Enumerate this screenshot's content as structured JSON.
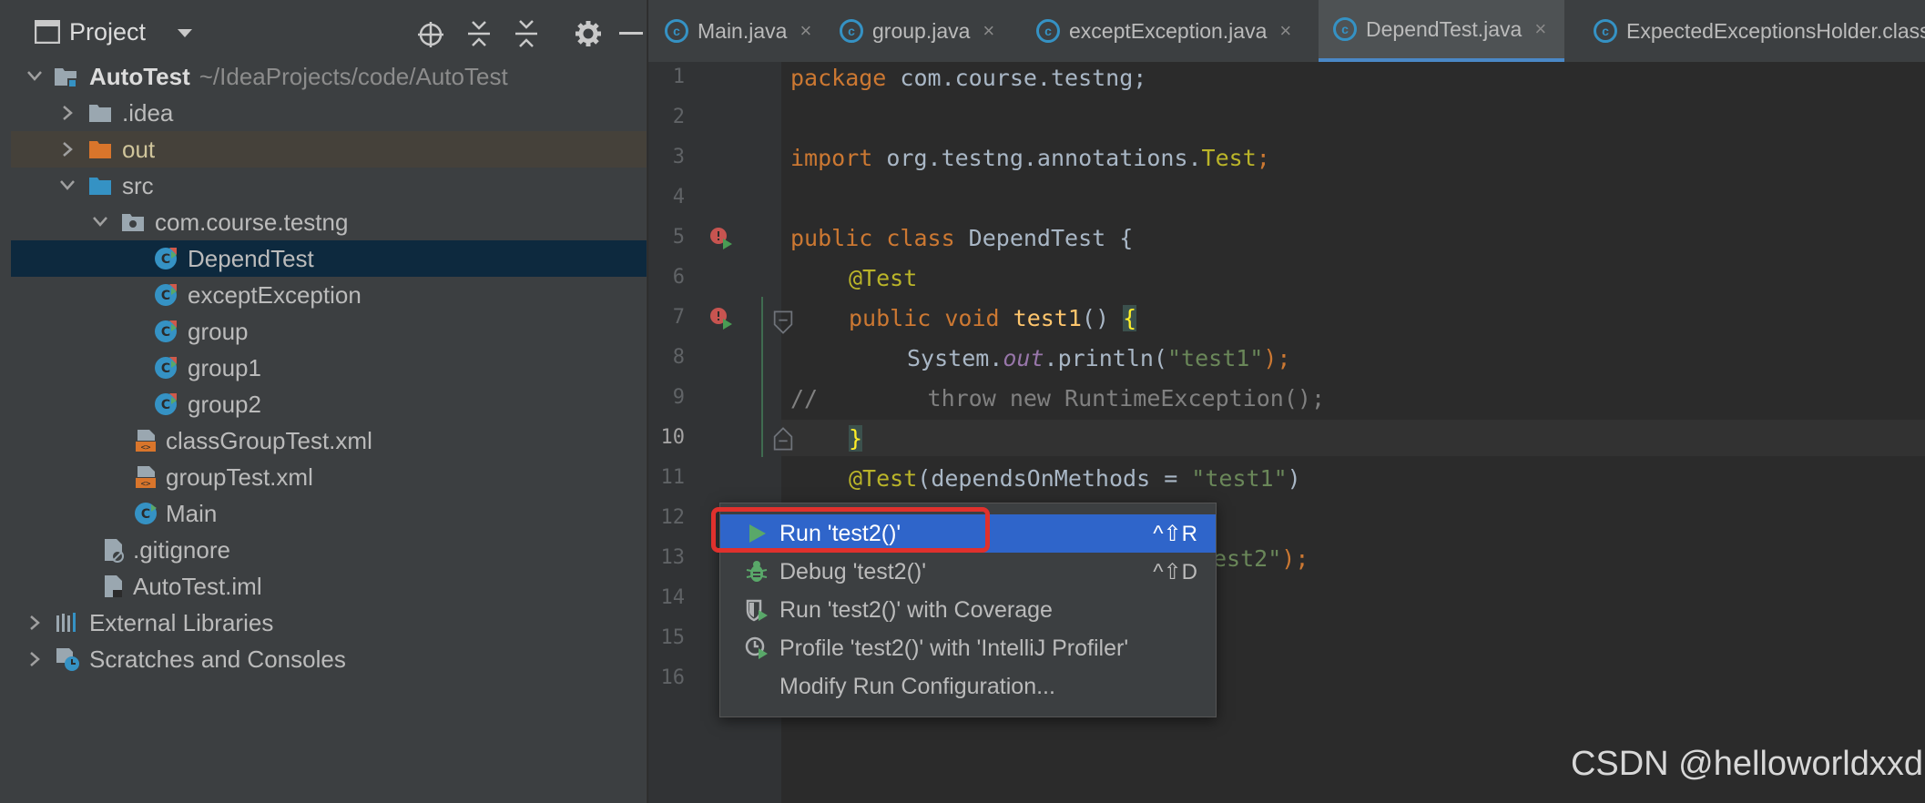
{
  "project_panel": {
    "title": "Project",
    "toolbar_icons": [
      "crosshair-icon",
      "expand-all-icon",
      "collapse-all-icon",
      "gear-icon",
      "minimize-icon"
    ],
    "tree": [
      {
        "label": "AutoTest",
        "path": "~/IdeaProjects/code/AutoTest",
        "icon": "module-folder-icon"
      },
      {
        "label": ".idea",
        "icon": "folder-icon"
      },
      {
        "label": "out",
        "icon": "excluded-folder-icon"
      },
      {
        "label": "src",
        "icon": "source-folder-icon"
      },
      {
        "label": "com.course.testng",
        "icon": "package-icon"
      },
      {
        "label": "DependTest",
        "icon": "test-class-icon"
      },
      {
        "label": "exceptException",
        "icon": "test-class-icon"
      },
      {
        "label": "group",
        "icon": "test-class-icon"
      },
      {
        "label": "group1",
        "icon": "test-class-icon"
      },
      {
        "label": "group2",
        "icon": "test-class-icon"
      },
      {
        "label": "classGroupTest.xml",
        "icon": "xml-file-icon"
      },
      {
        "label": "groupTest.xml",
        "icon": "xml-file-icon"
      },
      {
        "label": "Main",
        "icon": "class-run-icon"
      },
      {
        "label": ".gitignore",
        "icon": "ignore-file-icon"
      },
      {
        "label": "AutoTest.iml",
        "icon": "iml-file-icon"
      },
      {
        "label": "External Libraries",
        "icon": "libraries-icon"
      },
      {
        "label": "Scratches and Consoles",
        "icon": "scratches-icon"
      }
    ]
  },
  "tabs": [
    {
      "label": "Main.java",
      "close": "×"
    },
    {
      "label": "group.java",
      "close": "×"
    },
    {
      "label": "exceptException.java",
      "close": "×"
    },
    {
      "label": "DependTest.java",
      "close": "×",
      "active": true
    },
    {
      "label": "ExpectedExceptionsHolder.class"
    }
  ],
  "line_numbers": [
    "1",
    "2",
    "3",
    "4",
    "5",
    "6",
    "7",
    "8",
    "9",
    "10",
    "11",
    "12",
    "13",
    "14",
    "15",
    "16"
  ],
  "code": {
    "l1_kw": "package",
    "l1_rest": " com.course.testng;",
    "l3_kw": "import",
    "l3_rest": " org.testng.annotations.",
    "l3_cls": "Test",
    "l3_semi": ";",
    "l5_kw": "public class",
    "l5_rest": " DependTest {",
    "l6_an": "@Test",
    "l7_kw": "public void",
    "l7_fn": "test1",
    "l7_paren": "() ",
    "l7_brace": "{",
    "l8_a": "System.",
    "l8_out": "out",
    "l8_b": ".println(",
    "l8_str": "\"test1\"",
    "l8_c": ");",
    "l9": "//        throw new RuntimeException();",
    "l10_brace": "}",
    "l11_an": "@Test",
    "l11_a": "(dependsOnMethods = ",
    "l11_str": "\"test1\"",
    "l11_b": ")",
    "l13_str": "est2\"",
    "l13_c": ");"
  },
  "context_menu": [
    {
      "label": "Run 'test2()'",
      "shortcut": "^⇧R",
      "icon": "run-icon",
      "selected": true
    },
    {
      "label": "Debug 'test2()'",
      "shortcut": "^⇧D",
      "icon": "debug-icon"
    },
    {
      "label": "Run 'test2()' with Coverage",
      "shortcut": "",
      "icon": "coverage-icon"
    },
    {
      "label": "Profile 'test2()' with 'IntelliJ Profiler'",
      "shortcut": "",
      "icon": "profiler-icon"
    },
    {
      "label": "Modify Run Configuration...",
      "shortcut": ""
    }
  ],
  "colors": {
    "accent": "#2f65ca",
    "highlight_box": "#e0312d",
    "keyword": "#cc7832",
    "annotation": "#bbb529",
    "string": "#6a8759"
  },
  "watermark": "CSDN @helloworldxxd"
}
